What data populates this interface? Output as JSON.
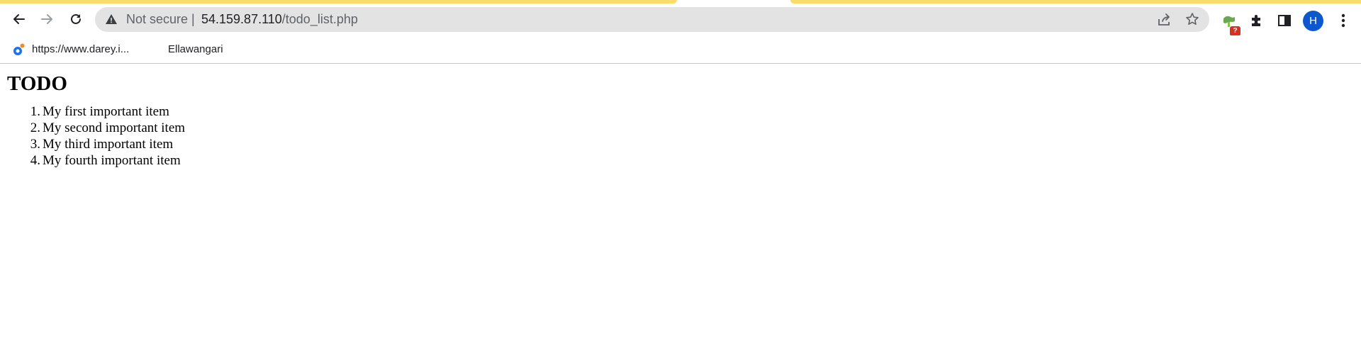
{
  "browser": {
    "omnibox": {
      "security_label": "Not secure",
      "separator": "|",
      "host": "54.159.87.110",
      "path": "/todo_list.php"
    },
    "profile_initial": "H",
    "extension_badge": "?",
    "accent_color": "#f9dc6b"
  },
  "bookmarks": [
    {
      "label": "https://www.darey.i..."
    },
    {
      "label": "Ellawangari"
    }
  ],
  "page": {
    "title": "TODO",
    "items": [
      {
        "num": "1.",
        "text": "My first important item"
      },
      {
        "num": "2.",
        "text": "My second important item"
      },
      {
        "num": "3.",
        "text": "My third important item"
      },
      {
        "num": "4.",
        "text": "My fourth important item"
      }
    ]
  }
}
